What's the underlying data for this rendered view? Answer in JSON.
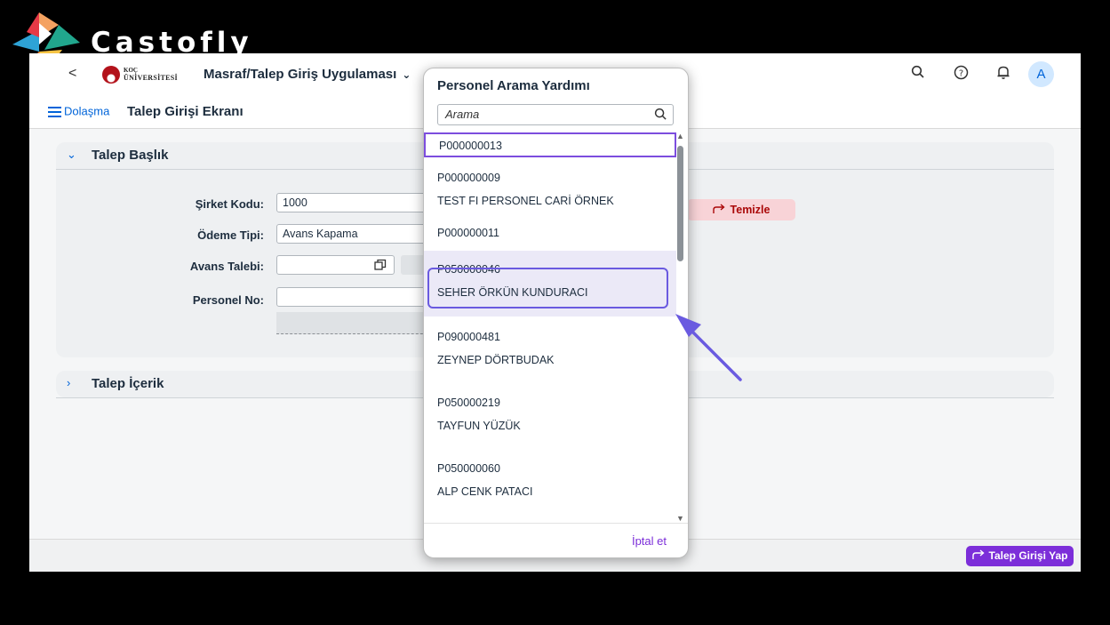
{
  "brand": {
    "name": "Castofly"
  },
  "shell": {
    "back_label": "<",
    "university_line1": "KOÇ",
    "university_line2": "ÜNİVERSİTESİ",
    "app_title": "Masraf/Talep Giriş Uygulaması",
    "avatar_initial": "A"
  },
  "subheader": {
    "nav_label": "Dolaşma",
    "page_title": "Talep Girişi Ekranı"
  },
  "header_panel": {
    "title": "Talep Başlık",
    "fields": [
      {
        "label": "Şirket Kodu:",
        "value": "1000"
      },
      {
        "label": "Ödeme Tipi:",
        "value": "Avans Kapama"
      },
      {
        "label": "Avans Talebi:",
        "value": ""
      },
      {
        "label": "Personel No:",
        "value": ""
      }
    ],
    "reset_label": "Temizle"
  },
  "content_panel": {
    "title": "Talep İçerik"
  },
  "footer": {
    "submit_label": "Talep Girişi Yap"
  },
  "dialog": {
    "title": "Personel Arama Yardımı",
    "search_placeholder": "Arama",
    "items": [
      {
        "code": "P000000013",
        "name": ""
      },
      {
        "code": "P000000009",
        "name": "TEST FI PERSONEL CARİ ÖRNEK"
      },
      {
        "code": "P000000011",
        "name": ""
      },
      {
        "code": "P050000046",
        "name": "SEHER ÖRKÜN KUNDURACI"
      },
      {
        "code": "P090000481",
        "name": "ZEYNEP DÖRTBUDAK"
      },
      {
        "code": "P050000219",
        "name": "TAYFUN YÜZÜK"
      },
      {
        "code": "P050000060",
        "name": "ALP CENK PATACI"
      }
    ],
    "cancel_label": "İptal et"
  },
  "colors": {
    "accent": "#7c2ed9",
    "highlight": "#6a5ae0",
    "reset_bg": "#f8d3d7",
    "link_blue": "#0064d9"
  }
}
